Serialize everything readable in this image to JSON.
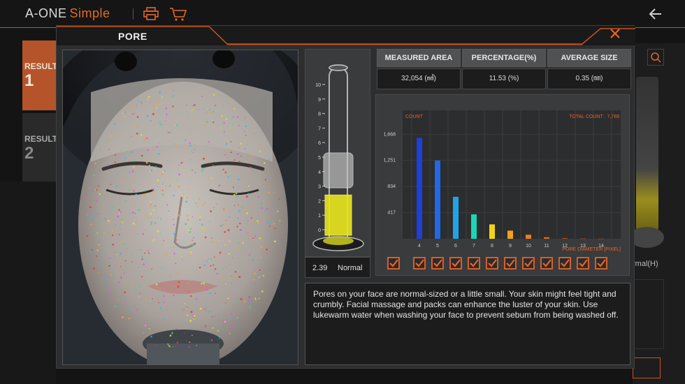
{
  "app": {
    "brand_main": "A-ONE",
    "brand_sub": "Simple",
    "icons": [
      "print-icon",
      "cart-icon",
      "back-arrow-icon"
    ]
  },
  "results": [
    {
      "label": "RESULT",
      "number": "1"
    },
    {
      "label": "RESULT",
      "number": "2"
    }
  ],
  "background_right_label": "rmal(H)",
  "modal": {
    "title": "PORE",
    "close_icon": "close-icon",
    "tube": {
      "scale": [
        "10",
        "9",
        "8",
        "7",
        "6",
        "5",
        "4",
        "3",
        "2",
        "1",
        "0"
      ],
      "level": 2.39,
      "value": "2.39",
      "status": "Normal"
    },
    "stats": [
      {
        "label": "MEASURED AREA",
        "value": "32,054 (㎟)"
      },
      {
        "label": "PERCENTAGE(%)",
        "value": "11.53 (%)"
      },
      {
        "label": "AVERAGE SIZE",
        "value": "0.35 (㎜)"
      }
    ],
    "description": "Pores on your face are normal-sized or a little small. Your skin might feel tight and crumbly. Facial massage and packs can enhance the luster of your skin. Use lukewarm water when washing your face to prevent sebum from being washed off."
  },
  "chart_data": {
    "type": "bar",
    "ylabel": "COUNT",
    "xlabel": "PORE DIAMETER [PIXEL]",
    "total_label": "TOTAL COUNT : 7,769",
    "categories": [
      "4",
      "5",
      "6",
      "7",
      "8",
      "9",
      "10",
      "11",
      "12",
      "13",
      "14"
    ],
    "values": [
      1610,
      1250,
      670,
      390,
      230,
      130,
      65,
      25,
      8,
      4,
      2
    ],
    "yticks": [
      "417",
      "834",
      "1,251",
      "1,668"
    ],
    "ytick_values": [
      417,
      834,
      1251,
      1668
    ],
    "ylim": [
      0,
      2050
    ],
    "colors": [
      "#1f3fd6",
      "#2267e4",
      "#1fa4e6",
      "#1ed3b6",
      "#f1d21a",
      "#f0a21a",
      "#ec7e1e",
      "#e8641e",
      "#e05a1e",
      "#d8541e",
      "#d04e1e"
    ],
    "grid": true,
    "checkboxes": [
      true,
      true,
      true,
      true,
      true,
      true,
      true,
      true,
      true,
      true,
      true,
      true
    ]
  }
}
